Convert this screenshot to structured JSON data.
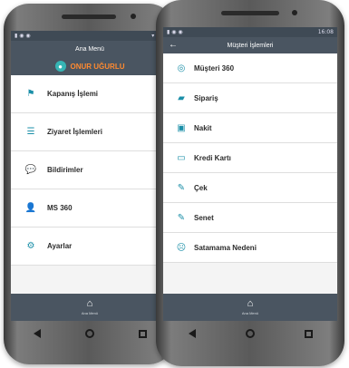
{
  "left_phone": {
    "status_icons": "▮ ◉ ◉",
    "status_right": "▾ ◢ ▮",
    "title": "Ana Menü",
    "user": "ONUR UĞURLU",
    "menu": [
      {
        "label": "Kapanış İşlemi",
        "icon": "flag-icon"
      },
      {
        "label": "Ziyaret İşlemleri",
        "icon": "list-icon"
      },
      {
        "label": "Bildirimler",
        "icon": "chat-icon"
      },
      {
        "label": "MS 360",
        "icon": "person-icon"
      },
      {
        "label": "Ayarlar",
        "icon": "gear-icon"
      }
    ],
    "bottom_label": "Ana Menü"
  },
  "right_phone": {
    "status_icons": "▮ ◉ ◉",
    "status_time": "16:08",
    "title": "Müşteri İşlemleri",
    "menu": [
      {
        "label": "Müşteri 360",
        "icon": "binoculars-icon"
      },
      {
        "label": "Sipariş",
        "icon": "truck-icon"
      },
      {
        "label": "Nakit",
        "icon": "cash-icon"
      },
      {
        "label": "Kredi Kartı",
        "icon": "credit-card-icon"
      },
      {
        "label": "Çek",
        "icon": "edit-icon"
      },
      {
        "label": "Senet",
        "icon": "edit-icon"
      },
      {
        "label": "Satamama Nedeni",
        "icon": "sad-face-icon"
      }
    ],
    "bottom_label": "Ana Menü"
  },
  "colors": {
    "accent": "#1b8fa8",
    "bar": "#4a5561",
    "user": "#ff8a30"
  }
}
